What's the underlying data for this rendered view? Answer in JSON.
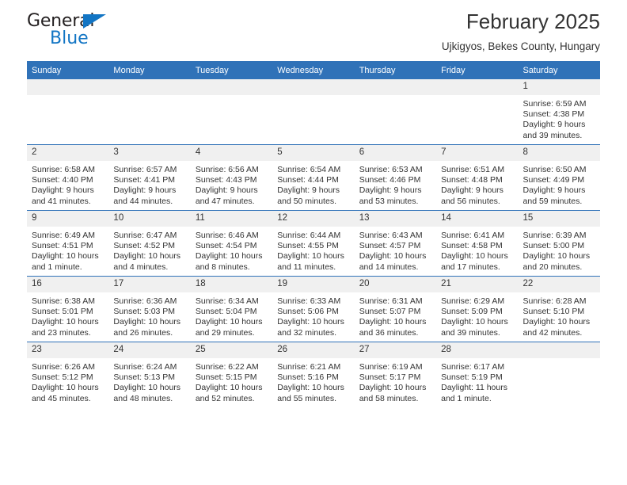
{
  "brand": {
    "name_part1": "General",
    "name_part2": "Blue",
    "triangle_color": "#1275c4"
  },
  "header": {
    "title": "February 2025",
    "subtitle": "Ujkigyos, Bekes County, Hungary",
    "accent_color": "#3072b8",
    "daynum_bg": "#f0f0f0"
  },
  "weekdays": [
    "Sunday",
    "Monday",
    "Tuesday",
    "Wednesday",
    "Thursday",
    "Friday",
    "Saturday"
  ],
  "labels": {
    "sunrise": "Sunrise:",
    "sunset": "Sunset:",
    "daylight": "Daylight:"
  },
  "weeks": [
    [
      {
        "day": ""
      },
      {
        "day": ""
      },
      {
        "day": ""
      },
      {
        "day": ""
      },
      {
        "day": ""
      },
      {
        "day": ""
      },
      {
        "day": "1",
        "sunrise": "Sunrise: 6:59 AM",
        "sunset": "Sunset: 4:38 PM",
        "daylight_1": "Daylight: 9 hours",
        "daylight_2": "and 39 minutes."
      }
    ],
    [
      {
        "day": "2",
        "sunrise": "Sunrise: 6:58 AM",
        "sunset": "Sunset: 4:40 PM",
        "daylight_1": "Daylight: 9 hours",
        "daylight_2": "and 41 minutes."
      },
      {
        "day": "3",
        "sunrise": "Sunrise: 6:57 AM",
        "sunset": "Sunset: 4:41 PM",
        "daylight_1": "Daylight: 9 hours",
        "daylight_2": "and 44 minutes."
      },
      {
        "day": "4",
        "sunrise": "Sunrise: 6:56 AM",
        "sunset": "Sunset: 4:43 PM",
        "daylight_1": "Daylight: 9 hours",
        "daylight_2": "and 47 minutes."
      },
      {
        "day": "5",
        "sunrise": "Sunrise: 6:54 AM",
        "sunset": "Sunset: 4:44 PM",
        "daylight_1": "Daylight: 9 hours",
        "daylight_2": "and 50 minutes."
      },
      {
        "day": "6",
        "sunrise": "Sunrise: 6:53 AM",
        "sunset": "Sunset: 4:46 PM",
        "daylight_1": "Daylight: 9 hours",
        "daylight_2": "and 53 minutes."
      },
      {
        "day": "7",
        "sunrise": "Sunrise: 6:51 AM",
        "sunset": "Sunset: 4:48 PM",
        "daylight_1": "Daylight: 9 hours",
        "daylight_2": "and 56 minutes."
      },
      {
        "day": "8",
        "sunrise": "Sunrise: 6:50 AM",
        "sunset": "Sunset: 4:49 PM",
        "daylight_1": "Daylight: 9 hours",
        "daylight_2": "and 59 minutes."
      }
    ],
    [
      {
        "day": "9",
        "sunrise": "Sunrise: 6:49 AM",
        "sunset": "Sunset: 4:51 PM",
        "daylight_1": "Daylight: 10 hours",
        "daylight_2": "and 1 minute."
      },
      {
        "day": "10",
        "sunrise": "Sunrise: 6:47 AM",
        "sunset": "Sunset: 4:52 PM",
        "daylight_1": "Daylight: 10 hours",
        "daylight_2": "and 4 minutes."
      },
      {
        "day": "11",
        "sunrise": "Sunrise: 6:46 AM",
        "sunset": "Sunset: 4:54 PM",
        "daylight_1": "Daylight: 10 hours",
        "daylight_2": "and 8 minutes."
      },
      {
        "day": "12",
        "sunrise": "Sunrise: 6:44 AM",
        "sunset": "Sunset: 4:55 PM",
        "daylight_1": "Daylight: 10 hours",
        "daylight_2": "and 11 minutes."
      },
      {
        "day": "13",
        "sunrise": "Sunrise: 6:43 AM",
        "sunset": "Sunset: 4:57 PM",
        "daylight_1": "Daylight: 10 hours",
        "daylight_2": "and 14 minutes."
      },
      {
        "day": "14",
        "sunrise": "Sunrise: 6:41 AM",
        "sunset": "Sunset: 4:58 PM",
        "daylight_1": "Daylight: 10 hours",
        "daylight_2": "and 17 minutes."
      },
      {
        "day": "15",
        "sunrise": "Sunrise: 6:39 AM",
        "sunset": "Sunset: 5:00 PM",
        "daylight_1": "Daylight: 10 hours",
        "daylight_2": "and 20 minutes."
      }
    ],
    [
      {
        "day": "16",
        "sunrise": "Sunrise: 6:38 AM",
        "sunset": "Sunset: 5:01 PM",
        "daylight_1": "Daylight: 10 hours",
        "daylight_2": "and 23 minutes."
      },
      {
        "day": "17",
        "sunrise": "Sunrise: 6:36 AM",
        "sunset": "Sunset: 5:03 PM",
        "daylight_1": "Daylight: 10 hours",
        "daylight_2": "and 26 minutes."
      },
      {
        "day": "18",
        "sunrise": "Sunrise: 6:34 AM",
        "sunset": "Sunset: 5:04 PM",
        "daylight_1": "Daylight: 10 hours",
        "daylight_2": "and 29 minutes."
      },
      {
        "day": "19",
        "sunrise": "Sunrise: 6:33 AM",
        "sunset": "Sunset: 5:06 PM",
        "daylight_1": "Daylight: 10 hours",
        "daylight_2": "and 32 minutes."
      },
      {
        "day": "20",
        "sunrise": "Sunrise: 6:31 AM",
        "sunset": "Sunset: 5:07 PM",
        "daylight_1": "Daylight: 10 hours",
        "daylight_2": "and 36 minutes."
      },
      {
        "day": "21",
        "sunrise": "Sunrise: 6:29 AM",
        "sunset": "Sunset: 5:09 PM",
        "daylight_1": "Daylight: 10 hours",
        "daylight_2": "and 39 minutes."
      },
      {
        "day": "22",
        "sunrise": "Sunrise: 6:28 AM",
        "sunset": "Sunset: 5:10 PM",
        "daylight_1": "Daylight: 10 hours",
        "daylight_2": "and 42 minutes."
      }
    ],
    [
      {
        "day": "23",
        "sunrise": "Sunrise: 6:26 AM",
        "sunset": "Sunset: 5:12 PM",
        "daylight_1": "Daylight: 10 hours",
        "daylight_2": "and 45 minutes."
      },
      {
        "day": "24",
        "sunrise": "Sunrise: 6:24 AM",
        "sunset": "Sunset: 5:13 PM",
        "daylight_1": "Daylight: 10 hours",
        "daylight_2": "and 48 minutes."
      },
      {
        "day": "25",
        "sunrise": "Sunrise: 6:22 AM",
        "sunset": "Sunset: 5:15 PM",
        "daylight_1": "Daylight: 10 hours",
        "daylight_2": "and 52 minutes."
      },
      {
        "day": "26",
        "sunrise": "Sunrise: 6:21 AM",
        "sunset": "Sunset: 5:16 PM",
        "daylight_1": "Daylight: 10 hours",
        "daylight_2": "and 55 minutes."
      },
      {
        "day": "27",
        "sunrise": "Sunrise: 6:19 AM",
        "sunset": "Sunset: 5:17 PM",
        "daylight_1": "Daylight: 10 hours",
        "daylight_2": "and 58 minutes."
      },
      {
        "day": "28",
        "sunrise": "Sunrise: 6:17 AM",
        "sunset": "Sunset: 5:19 PM",
        "daylight_1": "Daylight: 11 hours",
        "daylight_2": "and 1 minute."
      },
      {
        "day": ""
      }
    ]
  ]
}
